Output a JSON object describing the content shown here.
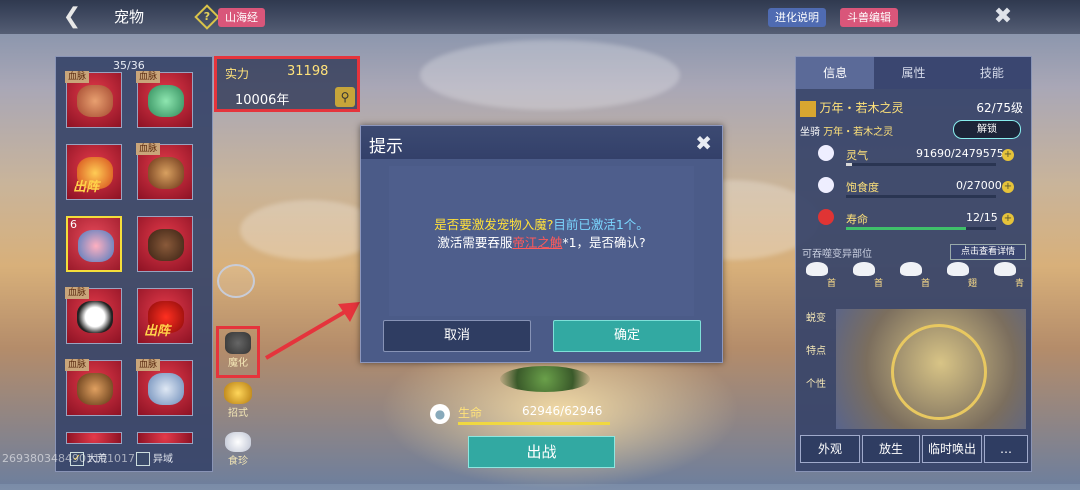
{
  "topbar": {
    "title": "宠物",
    "shanhai_label": "山海经",
    "evolve_label": "进化说明",
    "editor_label": "斗兽编辑"
  },
  "pet_list": {
    "count": "35/36",
    "blood_tag": "血脉",
    "chuzhen": "出阵",
    "selected_badge": "6",
    "filter_dahuang": "大荒",
    "filter_yiyu": "异域",
    "id_text": "2693803484901101017"
  },
  "power": {
    "label": "实力",
    "value": "31198",
    "years": "10006年"
  },
  "side_icons": {
    "mohua": "魔化",
    "zhaoshi": "招式",
    "shizhen": "食珍"
  },
  "dialog": {
    "title": "提示",
    "line1_a": "是否要激发宠物入魔?",
    "line1_b": "目前已激活1个。",
    "line2_a": "激活需要吞服",
    "line2_item": "帝江之触",
    "line2_b": "*1，是否确认?",
    "cancel": "取消",
    "confirm": "确定"
  },
  "bottom": {
    "life_label": "生命",
    "life_value": "62946/62946",
    "fight": "出战"
  },
  "right_panel": {
    "tabs": [
      "信息",
      "属性",
      "技能"
    ],
    "pet_name": "万年・若木之灵",
    "level": "62/75级",
    "mount_label": "坐骑",
    "mount_name": "万年・若木之灵",
    "unlock": "解锁",
    "lingqi_label": "灵气",
    "lingqi_value": "91690/2479575",
    "lingqi_fraction": 0.037,
    "bao_label": "饱食度",
    "bao_value": "0/27000",
    "bao_fraction": 0,
    "life_label": "寿命",
    "life_value": "12/15",
    "life_fraction": 0.8,
    "swallow_label": "可吞噬变异部位",
    "detail_link": "点击查看详情",
    "parts": [
      "首",
      "首",
      "首",
      "翅",
      "青"
    ],
    "side_tabs": [
      "蜕变",
      "特点",
      "个性"
    ],
    "btn_waiguan": "外观",
    "btn_fangsheng": "放生",
    "btn_linshi": "临时唤出",
    "btn_more": "…"
  }
}
